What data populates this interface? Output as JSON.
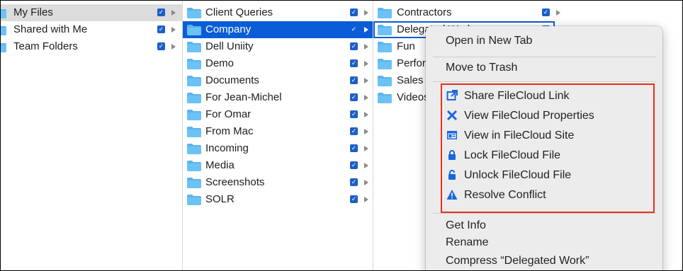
{
  "column1": {
    "items": [
      {
        "label": "My Files",
        "state": "gray"
      },
      {
        "label": "Shared with Me",
        "state": ""
      },
      {
        "label": "Team Folders",
        "state": ""
      }
    ]
  },
  "column2": {
    "items": [
      {
        "label": "Client Queries",
        "state": ""
      },
      {
        "label": "Company",
        "state": "blue"
      },
      {
        "label": "Dell Uniity",
        "state": ""
      },
      {
        "label": "Demo",
        "state": ""
      },
      {
        "label": "Documents",
        "state": ""
      },
      {
        "label": "For Jean-Michel",
        "state": ""
      },
      {
        "label": "For Omar",
        "state": ""
      },
      {
        "label": "From Mac",
        "state": ""
      },
      {
        "label": "Incoming",
        "state": ""
      },
      {
        "label": "Media",
        "state": ""
      },
      {
        "label": "Screenshots",
        "state": ""
      },
      {
        "label": "SOLR",
        "state": ""
      }
    ]
  },
  "column3": {
    "items": [
      {
        "label": "Contractors",
        "state": ""
      },
      {
        "label": "Delegated Work",
        "state": "outline"
      },
      {
        "label": "Fun",
        "state": ""
      },
      {
        "label": "Performance",
        "state": ""
      },
      {
        "label": "Sales",
        "state": ""
      },
      {
        "label": "Videos",
        "state": ""
      }
    ]
  },
  "context_menu": {
    "open_new_tab": "Open in New Tab",
    "move_to_trash": "Move to Trash",
    "filecloud_items": [
      {
        "label": "Share FileCloud Link",
        "icon": "share-link-icon"
      },
      {
        "label": "View FileCloud Properties",
        "icon": "tools-icon"
      },
      {
        "label": "View in FileCloud Site",
        "icon": "browser-window-icon"
      },
      {
        "label": "Lock FileCloud File",
        "icon": "lock-icon"
      },
      {
        "label": "Unlock FileCloud File",
        "icon": "unlock-icon"
      },
      {
        "label": "Resolve Conflict",
        "icon": "warning-icon"
      }
    ],
    "get_info": "Get Info",
    "rename": "Rename",
    "compress": "Compress “Delegated Work”"
  },
  "colors": {
    "selection_blue": "#0a5dd6",
    "folder_blue": "#5ab4ef",
    "highlight_red": "#e8321e",
    "icon_blue": "#1a66e0"
  }
}
